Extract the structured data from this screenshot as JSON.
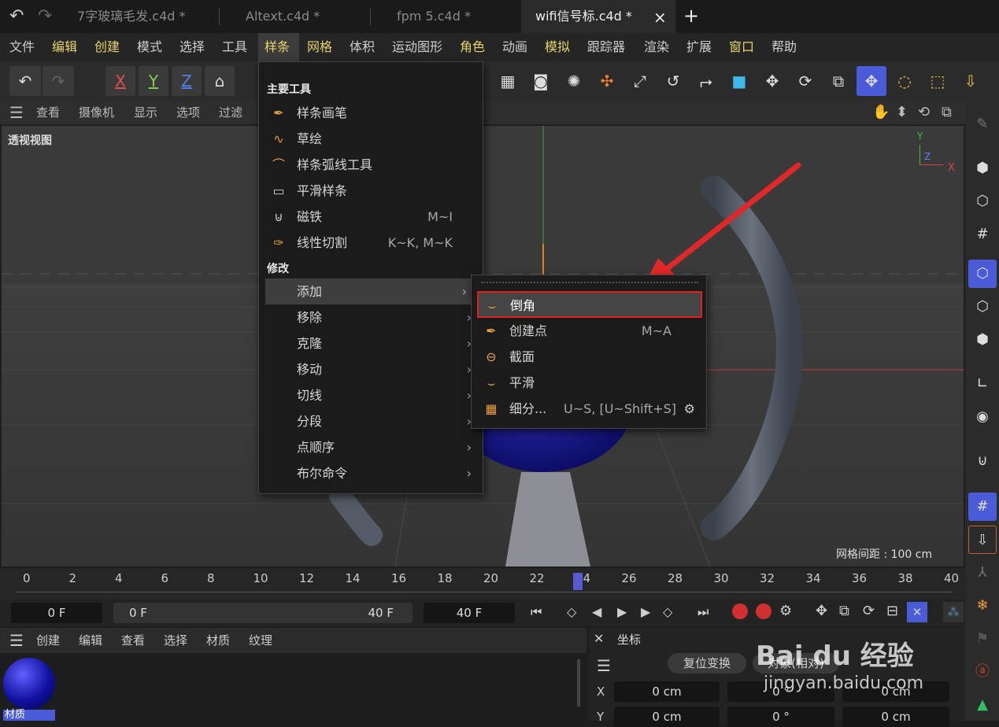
{
  "tabs": [
    {
      "label": "7字玻璃毛发.c4d *"
    },
    {
      "label": "Altext.c4d *"
    },
    {
      "label": "fpm 5.c4d *"
    },
    {
      "label": "wifi信号标.c4d *"
    }
  ],
  "tab_close": "×",
  "tab_add": "+",
  "menubar": [
    "文件",
    "编辑",
    "创建",
    "模式",
    "选择",
    "工具",
    "样条",
    "网格",
    "体积",
    "运动图形",
    "角色",
    "动画",
    "模拟",
    "跟踪器",
    "渲染",
    "扩展",
    "窗口",
    "帮助"
  ],
  "toolbar": {
    "x": "X",
    "y": "Y",
    "z": "Z"
  },
  "viewport_menu": [
    "查看",
    "摄像机",
    "显示",
    "选项",
    "过滤"
  ],
  "viewport": {
    "label": "透视视图",
    "grid_info": "网格间距 : 100 cm",
    "axes": {
      "y": "Y",
      "z": "Z",
      "x": "X"
    }
  },
  "spline_menu": {
    "section_main": "主要工具",
    "main_items": [
      {
        "label": "样条画笔",
        "shortcut": ""
      },
      {
        "label": "草绘",
        "shortcut": ""
      },
      {
        "label": "样条弧线工具",
        "shortcut": ""
      },
      {
        "label": "平滑样条",
        "shortcut": ""
      },
      {
        "label": "磁铁",
        "shortcut": "M~I"
      },
      {
        "label": "线性切割",
        "shortcut": "K~K, M~K"
      }
    ],
    "section_modify": "修改",
    "modify_items": [
      "添加",
      "移除",
      "克隆",
      "移动",
      "切线",
      "分段",
      "点顺序",
      "布尔命令"
    ]
  },
  "add_submenu": [
    {
      "label": "倒角",
      "shortcut": ""
    },
    {
      "label": "创建点",
      "shortcut": "M~A"
    },
    {
      "label": "截面",
      "shortcut": ""
    },
    {
      "label": "平滑",
      "shortcut": ""
    },
    {
      "label": "细分...",
      "shortcut": "U~S, [U~Shift+S]"
    }
  ],
  "timeline": {
    "ticks": [
      "0",
      "2",
      "4",
      "6",
      "8",
      "10",
      "12",
      "14",
      "16",
      "18",
      "20",
      "22",
      "24",
      "26",
      "28",
      "30",
      "32",
      "34",
      "36",
      "38",
      "40"
    ]
  },
  "time_fields": {
    "current": "0 F",
    "range_start": "0 F",
    "range_end": "40 F",
    "end": "40 F"
  },
  "bottom_menu": [
    "创建",
    "编辑",
    "查看",
    "选择",
    "材质",
    "纹理"
  ],
  "material": {
    "name": "材质"
  },
  "coords": {
    "title": "坐标",
    "reset_button": "复位变换",
    "mode": "对象(相对)",
    "rows": [
      {
        "axis": "X",
        "pos": "0 cm",
        "rot": "0 °",
        "scale": "0 cm"
      },
      {
        "axis": "Y",
        "pos": "0 cm",
        "rot": "0 °",
        "scale": "0 cm"
      }
    ]
  },
  "watermark": {
    "brand": "Bai du 经验",
    "url": "jingyan.baidu.com"
  },
  "colors": {
    "accent_yellow": "#e6d36a",
    "highlight_red": "#e02020",
    "selected_blue": "#4a5bd8"
  }
}
